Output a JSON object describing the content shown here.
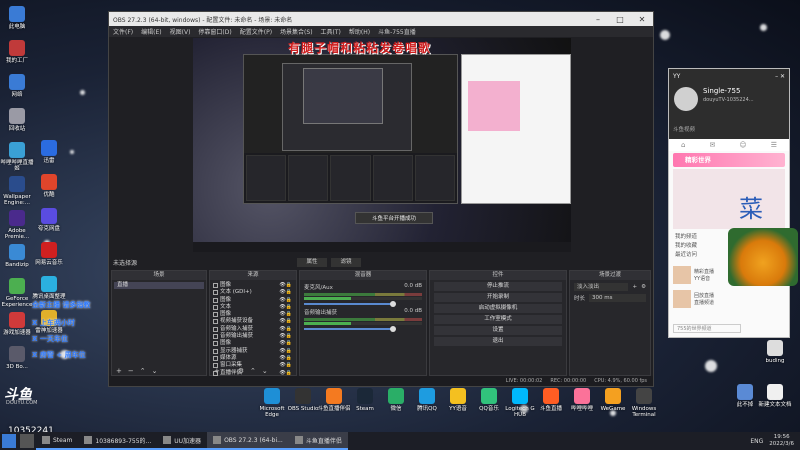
{
  "desktop": {
    "icons_left": [
      {
        "label": "此电脑",
        "color": "#3a7bd5"
      },
      {
        "label": "我的工厂",
        "color": "#c03a3a"
      },
      {
        "label": "网络",
        "color": "#3a7bd5"
      },
      {
        "label": "回收站",
        "color": "#9a9aa5"
      },
      {
        "label": "哔哩哔哩直播姬",
        "color": "#3aa0d5"
      },
      {
        "label": "Wallpaper Engine:...",
        "color": "#2a4c8c"
      },
      {
        "label": "Adobe Premie...",
        "color": "#4a2a8c"
      },
      {
        "label": "Bandizip",
        "color": "#3a8ad5"
      },
      {
        "label": "GeForce Experience",
        "color": "#4caf50"
      },
      {
        "label": "游戏加速器",
        "color": "#d03a3a"
      },
      {
        "label": "3D Bo...",
        "color": "#5a5a6a"
      }
    ],
    "icons_col2": [
      {
        "label": "迅雷",
        "color": "#2b6ce0"
      },
      {
        "label": "优酷",
        "color": "#e0452b"
      },
      {
        "label": "夸克网盘",
        "color": "#5a4ce0"
      },
      {
        "label": "网易云音乐",
        "color": "#d02020"
      },
      {
        "label": "腾讯桌面整理",
        "color": "#2bb0e0"
      },
      {
        "label": "雷神加速器",
        "color": "#e0b02b"
      }
    ],
    "bottom_icons": [
      {
        "label": "Microsoft Edge",
        "color": "#1e8fd6"
      },
      {
        "label": "OBS Studio",
        "color": "#333"
      },
      {
        "label": "斗鱼直播伴侣",
        "color": "#f47a20"
      },
      {
        "label": "Steam",
        "color": "#1b2838"
      },
      {
        "label": "微信",
        "color": "#2aae67"
      },
      {
        "label": "腾讯QQ",
        "color": "#1e9ce0"
      },
      {
        "label": "YY语音",
        "color": "#f4c020"
      },
      {
        "label": "QQ音乐",
        "color": "#31c27c"
      },
      {
        "label": "Logitech G HUB",
        "color": "#00b8fc"
      },
      {
        "label": "斗鱼直播",
        "color": "#ff5d23"
      },
      {
        "label": "哔哩哔哩",
        "color": "#fb7299"
      },
      {
        "label": "WeGame",
        "color": "#f4a020"
      },
      {
        "label": "Windows Terminal",
        "color": "#444"
      }
    ],
    "right_icons": [
      {
        "label": "buding",
        "color": "#ddd"
      },
      {
        "label": "此不掉",
        "color": "#5a8ad5"
      },
      {
        "label": "新建文本文档",
        "color": "#f0f0f0"
      }
    ],
    "room_id": "10352241",
    "watermark": "斗鱼",
    "watermark_sub": "DOUYU.COM",
    "side_notes": [
      "全新主播 请多指教",
      "X 上车两小时",
      "X 一天车位",
      "X 房管 + 周车位"
    ]
  },
  "obs": {
    "title": "OBS 27.2.3 (64-bit, windows) - 配置文件: 未命名 - 场景: 未命名",
    "menu": [
      "文件(F)",
      "编辑(E)",
      "视图(V)",
      "停靠窗口(D)",
      "配置文件(P)",
      "场景集合(S)",
      "工具(T)",
      "帮助(H)",
      "斗鱼-755直播"
    ],
    "overlay_text": "有腿子帽和粘粘发卷唱歌",
    "toast": "斗鱼平台开播成功",
    "no_source_label": "未选择源",
    "sub_buttons": [
      "属性",
      "滤镜"
    ],
    "docks": {
      "scenes": {
        "title": "场景",
        "items": [
          "直播"
        ]
      },
      "sources": {
        "title": "来源",
        "items": [
          "图像",
          "文本 (GDI+)",
          "图像",
          "文本",
          "图像",
          "视频捕获设备",
          "音频输入捕获",
          "音频输出捕获",
          "图像",
          "显示器捕获",
          "媒体源",
          "窗口采集",
          "直播伴侣"
        ]
      },
      "mixer": {
        "title": "混音器",
        "channels": [
          {
            "name": "麦克风/Aux",
            "db": "0.0 dB"
          },
          {
            "name": "音频输出捕获",
            "db": "0.0 dB"
          }
        ]
      },
      "controls": {
        "title": "控件",
        "buttons": [
          "停止推流",
          "开始录制",
          "启动虚拟摄像机",
          "工作室模式",
          "设置",
          "退出"
        ]
      },
      "transitions": {
        "title": "场景过渡",
        "type": "淡入淡出",
        "duration_label": "时长",
        "duration": "300 ms"
      }
    },
    "status": [
      "LIVE: 00:00:02",
      "REC: 00:00:00",
      "CPU: 4.9%, 60.00 fps"
    ]
  },
  "douyu": {
    "top_label": "YY",
    "username": "Single-755",
    "uid": "douyuTV-1035224...",
    "search_placeholder": "斗鱼视频",
    "banner": "精彩世界",
    "photo_glyph": "菜",
    "menu": [
      "我的频道",
      "我的收藏",
      "最近访问"
    ],
    "entries": [
      {
        "title": "精彩直播",
        "sub": "YY语音"
      },
      {
        "title": "回放直播",
        "sub": "直播频道"
      }
    ],
    "input_placeholder": "755的世界频道"
  },
  "taskbar": {
    "apps": [
      {
        "label": "Steam",
        "active": false
      },
      {
        "label": "10386893-755的...",
        "active": false
      },
      {
        "label": "UU加速器",
        "active": false
      },
      {
        "label": "OBS 27.2.3 (64-bi...",
        "active": true
      },
      {
        "label": "斗鱼直播伴侣",
        "active": true
      }
    ],
    "lang": "ENG",
    "time": "19:56",
    "date": "2022/3/6"
  },
  "colors": {
    "obs_bg": "#1f1f23",
    "accent_pink": "#ff77b0",
    "douyu_orange": "#f47a20"
  }
}
